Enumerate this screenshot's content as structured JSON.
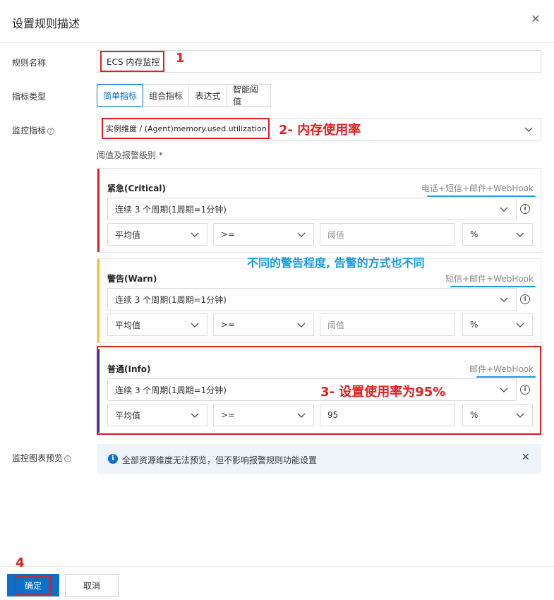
{
  "dialog": {
    "title": "设置规则描述",
    "close_glyph": "✕"
  },
  "rule_name": {
    "label": "规则名称",
    "value": "ECS 内存监控"
  },
  "metric_type": {
    "label": "指标类型",
    "tabs": [
      "简单指标",
      "组合指标",
      "表达式",
      "智能阈值"
    ],
    "active": "简单指标"
  },
  "metric": {
    "label": "监控指标",
    "value": "实例维度 / (Agent)memory.used.utilization"
  },
  "threshold_label": "阈值及报警级别 *",
  "levels": [
    {
      "title": "紧急(Critical)",
      "notify": "电话+短信+邮件+WebHook",
      "color": "#d9252a",
      "period": "连续 3 个周期(1周期=1分钟)",
      "stat": "平均值",
      "operator": ">=",
      "threshold_placeholder": "阈值",
      "threshold_value": "",
      "unit": "%"
    },
    {
      "title": "警告(Warn)",
      "notify": "短信+邮件+WebHook",
      "color": "#f5c12e",
      "period": "连续 3 个周期(1周期=1分钟)",
      "stat": "平均值",
      "operator": ">=",
      "threshold_placeholder": "阈值",
      "threshold_value": "",
      "unit": "%"
    },
    {
      "title": "普通(Info)",
      "notify": "邮件+WebHook",
      "color": "#1f3b9e",
      "period": "连续 3 个周期(1周期=1分钟)",
      "stat": "平均值",
      "operator": ">=",
      "threshold_placeholder": "阈值",
      "threshold_value": "95",
      "unit": "%"
    }
  ],
  "preview": {
    "label": "监控图表预览",
    "notice": "全部资源维度无法预览，但不影响报警规则功能设置"
  },
  "footer": {
    "confirm": "确定",
    "cancel": "取消"
  },
  "annotations": {
    "a1": "1",
    "a2": "2- 内存使用率",
    "a_mid": "不同的警告程度, 告警的方式也不同",
    "a3": "3- 设置使用率为95%",
    "a4": "4"
  },
  "colors": {
    "accent": "#0a70c9",
    "annotation_red": "#e02020",
    "annotation_blue": "#1a9ae0"
  }
}
